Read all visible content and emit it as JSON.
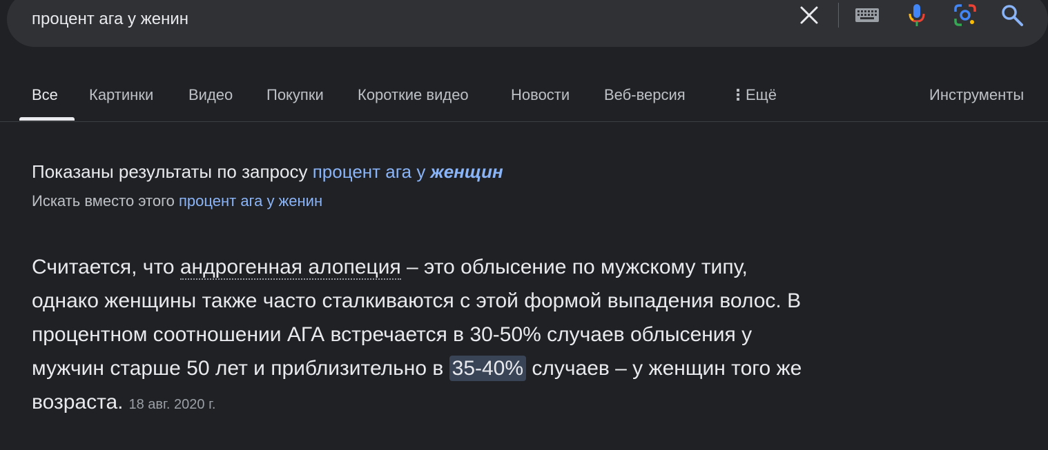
{
  "search": {
    "query": "процент ага у женин",
    "icons": {
      "clear": "close-icon",
      "keyboard": "keyboard-icon",
      "voice": "microphone-icon",
      "lens": "google-lens-icon",
      "search": "search-icon"
    }
  },
  "tabs": {
    "all": "Все",
    "images": "Картинки",
    "video": "Видео",
    "shopping": "Покупки",
    "short_video": "Короткие видео",
    "news": "Новости",
    "web": "Веб-версия",
    "more": "Ещё",
    "tools": "Инструменты"
  },
  "correction": {
    "showing_prefix": "Показаны результаты по запросу",
    "corrected_query_start": "процент ага у ",
    "corrected_query_emph": "женщин",
    "instead_prefix": "Искать вместо этого",
    "original_query": "процент ага у женин"
  },
  "snippet": {
    "part1": "Считается, что ",
    "term": "андрогенная алопеция",
    "part2": " – это облысение по мужскому типу, однако женщины также часто сталкиваются с этой формой выпадения волос. В процентном соотношении АГА встречается в 30-50% случаев облысения у мужчин старше 50 лет и приблизительно в ",
    "highlight": "35-40%",
    "part3": " случаев – у женщин того же возраста.",
    "date": "18 авг. 2020 г."
  },
  "colors": {
    "background": "#202124",
    "searchbar": "#303134",
    "link": "#8ab4f8",
    "highlight": "#394457"
  }
}
